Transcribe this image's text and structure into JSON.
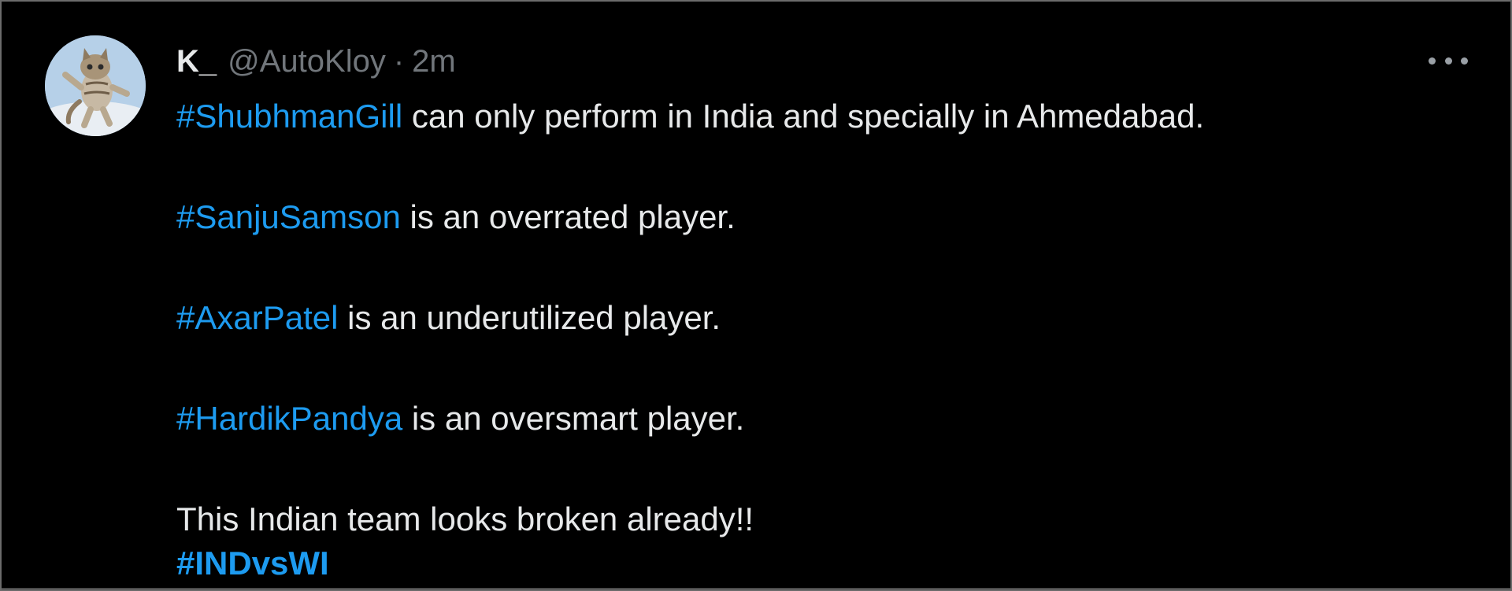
{
  "colors": {
    "background": "#000000",
    "text": "#e7e9ea",
    "muted": "#71767b",
    "hashtag": "#1d9bf0"
  },
  "author": {
    "display_name": "K_",
    "handle": "@AutoKloy",
    "separator": "·",
    "time": "2m",
    "avatar_icon": "cat-avatar"
  },
  "menu": {
    "more_icon": "more-horizontal-icon"
  },
  "tweet": {
    "paragraphs": [
      {
        "hashtag": "#ShubhmanGill",
        "text": " can only perform in India and specially in Ahmedabad."
      },
      {
        "hashtag": "#SanjuSamson",
        "text": " is an overrated player."
      },
      {
        "hashtag": "#AxarPatel",
        "text": " is an underutilized player."
      },
      {
        "hashtag": "#HardikPandya",
        "text": " is an oversmart player."
      }
    ],
    "closing_line": "This Indian team looks broken already!!",
    "final_hashtag": "#INDvsWI"
  }
}
